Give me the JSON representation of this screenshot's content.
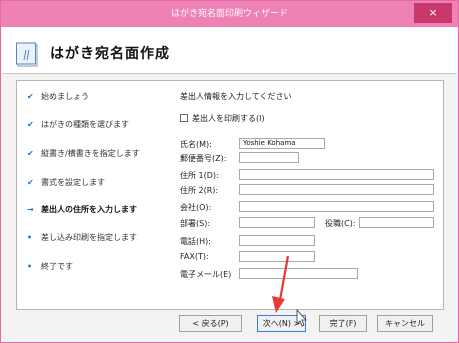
{
  "window": {
    "title": "はがき宛名面印刷ウィザード",
    "close_glyph": "×"
  },
  "header": {
    "title": "はがき宛名面作成"
  },
  "steps": [
    {
      "label": "始めましょう",
      "mark": "✔",
      "state": "done"
    },
    {
      "label": "はがきの種類を選びます",
      "mark": "✔",
      "state": "done"
    },
    {
      "label": "縦書き/横書きを指定します",
      "mark": "✔",
      "state": "done"
    },
    {
      "label": "書式を設定します",
      "mark": "✔",
      "state": "done"
    },
    {
      "label": "差出人の住所を入力します",
      "mark": "→",
      "state": "current"
    },
    {
      "label": "差し込み印刷を指定します",
      "mark": "•",
      "state": "pending"
    },
    {
      "label": "終了です",
      "mark": "•",
      "state": "pending"
    }
  ],
  "form": {
    "instruction": "差出人情報を入力してください",
    "print_sender_label": "差出人を印刷する(I)",
    "print_sender_checked": false,
    "name_label": "氏名(M):",
    "name_value": "Yoshie Kohama",
    "postal_label": "郵便番号(Z):",
    "postal_value": "",
    "address1_label": "住所 1(D):",
    "address1_value": "",
    "address2_label": "住所 2(R):",
    "address2_value": "",
    "company_label": "会社(O):",
    "company_value": "",
    "department_label": "部署(S):",
    "department_value": "",
    "title_label": "役職(C):",
    "title_value": "",
    "phone_label": "電話(H):",
    "phone_value": "",
    "fax_label": "FAX(T):",
    "fax_value": "",
    "email_label": "電子メール(E)",
    "email_value": ""
  },
  "buttons": {
    "back": "< 戻る(P)",
    "next": "次へ(N) >",
    "finish": "完了(F)",
    "cancel": "キャンセル"
  },
  "colors": {
    "titlebar": "#ef82b4",
    "close": "#c8386a",
    "annotation_arrow": "#e53935",
    "accent": "#1b73c7"
  },
  "icons": {
    "header": "postcard-icon",
    "annotation": "red-arrow-icon"
  }
}
